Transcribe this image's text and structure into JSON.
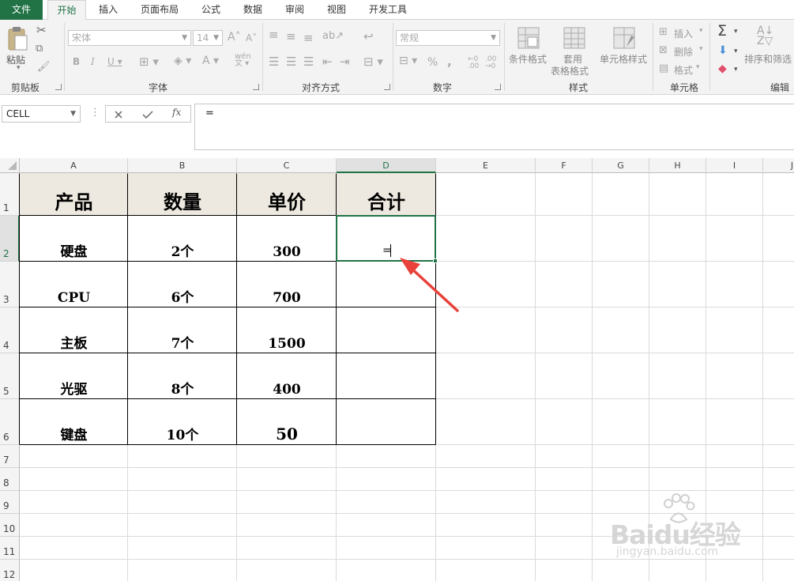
{
  "tabs": [
    "文件",
    "开始",
    "插入",
    "页面布局",
    "公式",
    "数据",
    "审阅",
    "视图",
    "开发工具"
  ],
  "ribbon": {
    "clipboard": {
      "paste": "粘贴",
      "label": "剪贴板"
    },
    "font": {
      "name": "宋体",
      "size": "14",
      "label": "字体"
    },
    "alignment": {
      "label": "对齐方式"
    },
    "number": {
      "format": "常规",
      "label": "数字",
      "percent": "%",
      "comma": ","
    },
    "styles": {
      "conditional": "条件格式",
      "table_line1": "套用",
      "table_line2": "表格格式",
      "cell_styles": "单元格样式",
      "label": "样式"
    },
    "cells": {
      "insert": "插入",
      "delete": "删除",
      "format": "格式",
      "label": "单元格"
    },
    "editing": {
      "sort_filter": "排序和筛选",
      "label": "编辑"
    }
  },
  "formula_bar": {
    "name_box": "CELL",
    "formula": "="
  },
  "columns": [
    "A",
    "B",
    "C",
    "D",
    "E",
    "F",
    "G",
    "H",
    "I",
    "J"
  ],
  "rows": [
    "1",
    "2",
    "3",
    "4",
    "5",
    "6",
    "7",
    "8",
    "9",
    "10",
    "11",
    "12"
  ],
  "table": {
    "headers": [
      "产品",
      "数量",
      "单价",
      "合计"
    ],
    "rows": [
      [
        "硬盘",
        "2个",
        "300",
        "="
      ],
      [
        "CPU",
        "6个",
        "700",
        ""
      ],
      [
        "主板",
        "7个",
        "1500",
        ""
      ],
      [
        "光驱",
        "8个",
        "400",
        ""
      ],
      [
        "键盘",
        "10个",
        "50",
        ""
      ]
    ]
  },
  "watermark": {
    "brand": "Baidu经验",
    "url": "jingyan.baidu.com"
  },
  "colors": {
    "accent": "#217346",
    "arrow": "#e8423a",
    "header_fill": "#ede9e0"
  }
}
